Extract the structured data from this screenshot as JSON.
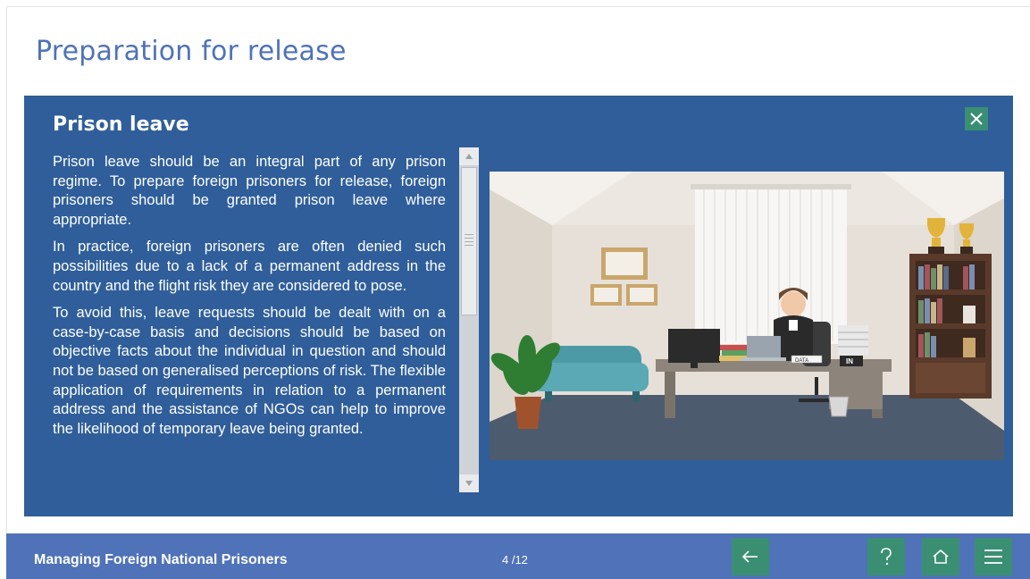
{
  "page": {
    "title": "Preparation for release"
  },
  "panel": {
    "title": "Prison leave",
    "paragraphs": [
      "Prison leave should be an integral part of any prison regime. To prepare foreign prisoners for release, foreign prisoners should be granted prison leave where appropriate.",
      "In practice, foreign prisoners are often denied such possibilities due to a lack of a permanent address in the country and the flight risk they are considered to pose.",
      "To avoid this, leave requests should be dealt with on a case-by-case basis and decisions should be based on objective facts about the individual in question and should not be based on generalised perceptions of risk. The flexible application of requirements in relation to a permanent address and the assistance of NGOs can help to improve the likelihood of temporary leave being granted."
    ],
    "close_icon": "close-icon",
    "illustration": {
      "label": "IN",
      "doc_label": "DATA"
    }
  },
  "footer": {
    "course_title": "Managing Foreign National Prisoners",
    "page_counter": "4 /12",
    "icons": [
      "arrow-left-icon",
      "help-icon",
      "home-icon",
      "menu-icon"
    ]
  },
  "colors": {
    "title_blue": "#4f72b8",
    "panel_blue": "#2f5e9a",
    "footer_blue": "#4f72b8",
    "button_green": "#3a8f73"
  }
}
